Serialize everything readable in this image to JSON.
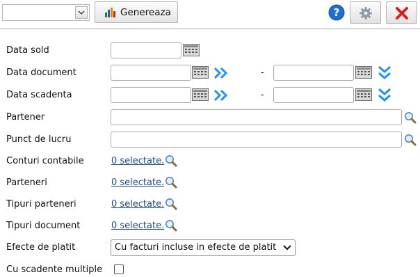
{
  "toolbar": {
    "combo_value": "",
    "generate_label": "Genereaza"
  },
  "form": {
    "data_sold_label": "Data sold",
    "data_document_label": "Data document",
    "data_scadenta_label": "Data scadenta",
    "partener_label": "Partener",
    "punct_lucru_label": "Punct de lucru",
    "conturi_label": "Conturi contabile",
    "parteneri_label": "Parteneri",
    "tipuri_parteneri_label": "Tipuri parteneri",
    "tipuri_document_label": "Tipuri document",
    "efecte_label": "Efecte de platit",
    "scadente_label": "Cu scadente multiple",
    "range_separator": "-",
    "selected_text": "0 selectate.",
    "efecte_value": "Cu facturi incluse in efecte de platit"
  },
  "colors": {
    "link": "#1a4a8a",
    "chevron": "#1e90ff",
    "help": "#1f6fd0",
    "close": "#d42020"
  },
  "icons": {
    "calendar": "calendar-icon",
    "search": "search-icon",
    "double_chevron_right": "double-chevron-right-icon",
    "double_chevron_down": "double-chevron-down-icon",
    "help": "help-icon",
    "settings": "gear-icon",
    "close": "close-icon",
    "chart": "bar-chart-icon"
  }
}
